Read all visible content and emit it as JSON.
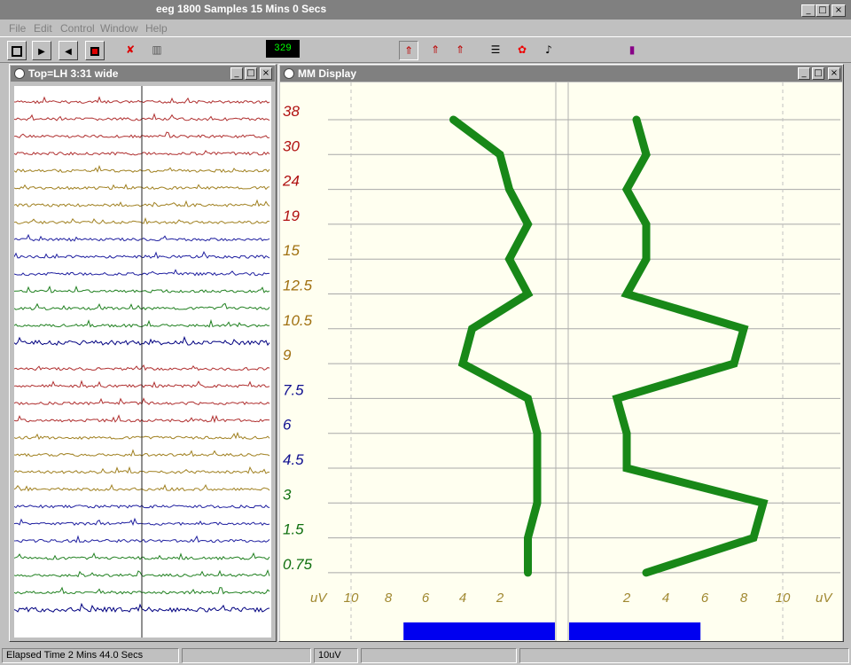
{
  "window": {
    "title": "eeg 1800 Samples 15 Mins 0 Secs"
  },
  "menu": [
    "File",
    "Edit",
    "Control",
    "Window",
    "Help"
  ],
  "toolbar": {
    "counter": "329",
    "icons": [
      "stop-icon",
      "play-icon",
      "rewind-icon",
      "record-icon",
      "delete-icon",
      "bookmark-icon",
      "slider-a",
      "slider-b",
      "arrow-up-1-icon",
      "arrow-up-2-icon",
      "arrow-up-3-icon",
      "list-icon",
      "red-shape-icon",
      "note-icon",
      "purple-device-icon"
    ]
  },
  "eeg_panel": {
    "title": "Top=LH 3:31 wide",
    "traces": [
      {
        "color": "#b03030"
      },
      {
        "color": "#b03030"
      },
      {
        "color": "#b03030"
      },
      {
        "color": "#b03030"
      },
      {
        "color": "#a08020"
      },
      {
        "color": "#a08020"
      },
      {
        "color": "#a08020"
      },
      {
        "color": "#a08020"
      },
      {
        "color": "#2020a0"
      },
      {
        "color": "#2020a0"
      },
      {
        "color": "#2020a0"
      },
      {
        "color": "#208020"
      },
      {
        "color": "#208020"
      },
      {
        "color": "#208020"
      },
      {
        "color": "#000080"
      },
      {
        "color": "#b03030"
      },
      {
        "color": "#b03030"
      },
      {
        "color": "#b03030"
      },
      {
        "color": "#b03030"
      },
      {
        "color": "#a08020"
      },
      {
        "color": "#a08020"
      },
      {
        "color": "#a08020"
      },
      {
        "color": "#a08020"
      },
      {
        "color": "#2020a0"
      },
      {
        "color": "#2020a0"
      },
      {
        "color": "#2020a0"
      },
      {
        "color": "#208020"
      },
      {
        "color": "#208020"
      },
      {
        "color": "#208020"
      },
      {
        "color": "#000080"
      }
    ]
  },
  "mm_panel": {
    "title": "MM Display",
    "frequencies": [
      {
        "label": "38",
        "color": "#b01010"
      },
      {
        "label": "30",
        "color": "#b01010"
      },
      {
        "label": "24",
        "color": "#b01010"
      },
      {
        "label": "19",
        "color": "#b01010"
      },
      {
        "label": "15",
        "color": "#a07010"
      },
      {
        "label": "12.5",
        "color": "#a07010"
      },
      {
        "label": "10.5",
        "color": "#a07010"
      },
      {
        "label": "9",
        "color": "#a07010"
      },
      {
        "label": "7.5",
        "color": "#101090"
      },
      {
        "label": "6",
        "color": "#101090"
      },
      {
        "label": "4.5",
        "color": "#101090"
      },
      {
        "label": "3",
        "color": "#107010"
      },
      {
        "label": "1.5",
        "color": "#107010"
      },
      {
        "label": "0.75",
        "color": "#107010"
      }
    ],
    "left_axis": {
      "unit": "uV",
      "ticks": [
        "10",
        "8",
        "6",
        "4",
        "2"
      ],
      "tick_values": [
        10,
        8,
        6,
        4,
        2
      ],
      "max": 10
    },
    "right_axis": {
      "unit": "uV",
      "ticks": [
        "2",
        "4",
        "6",
        "8",
        "10"
      ],
      "tick_values": [
        2,
        4,
        6,
        8,
        10
      ],
      "max": 10
    },
    "left_values": [
      4.5,
      2.0,
      1.5,
      0.5,
      1.5,
      0.5,
      3.5,
      4.0,
      0.5,
      0,
      0,
      0,
      0.5,
      0.5
    ],
    "right_values": [
      2.5,
      3.0,
      2.0,
      3.0,
      3.0,
      2.0,
      8.0,
      7.5,
      1.5,
      2.0,
      2.0,
      9.0,
      8.5,
      3.0
    ],
    "left_bar": 7.0,
    "right_bar": 6.5,
    "line_color": "#188818",
    "bar_color": "#0000f0"
  },
  "status": {
    "elapsed": "Elapsed Time 2 Mins 44.0 Secs",
    "scale": "10uV"
  }
}
